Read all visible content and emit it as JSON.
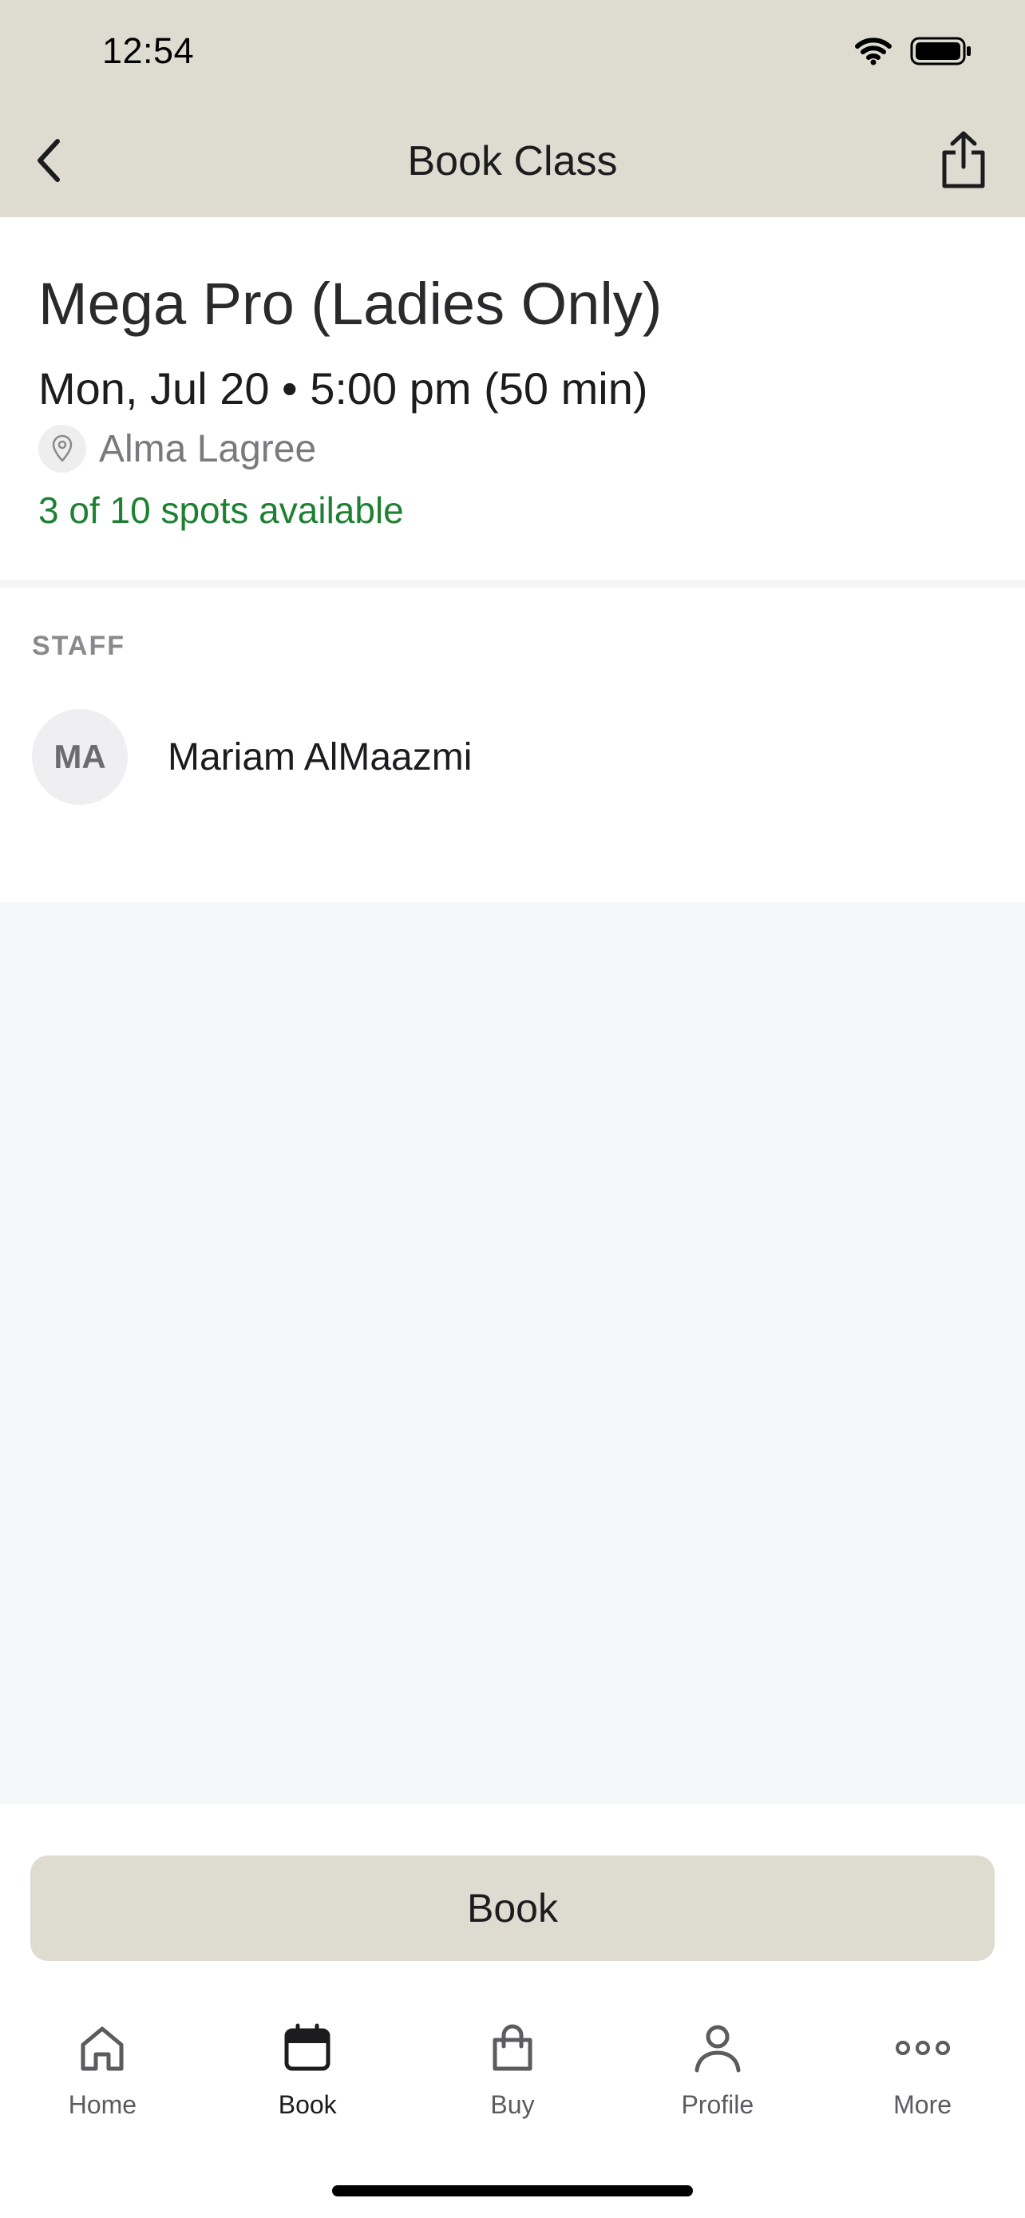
{
  "status_bar": {
    "time": "12:54"
  },
  "nav": {
    "title": "Book Class"
  },
  "class": {
    "name": "Mega Pro (Ladies Only)",
    "datetime": "Mon, Jul 20 • 5:00 pm (50 min)",
    "location": "Alma Lagree",
    "availability": "3 of 10 spots available"
  },
  "staff": {
    "label": "STAFF",
    "members": [
      {
        "initials": "MA",
        "name": "Mariam AlMaazmi"
      }
    ]
  },
  "actions": {
    "book_label": "Book"
  },
  "tabs": [
    {
      "label": "Home",
      "icon": "home-icon"
    },
    {
      "label": "Book",
      "icon": "calendar-icon",
      "active": true
    },
    {
      "label": "Buy",
      "icon": "shopping-bag-icon"
    },
    {
      "label": "Profile",
      "icon": "person-icon"
    },
    {
      "label": "More",
      "icon": "more-dots-icon"
    }
  ],
  "colors": {
    "header_bg": "#dedcd0",
    "accent_green": "#1e8033",
    "book_button_bg": "#dedcd0"
  }
}
